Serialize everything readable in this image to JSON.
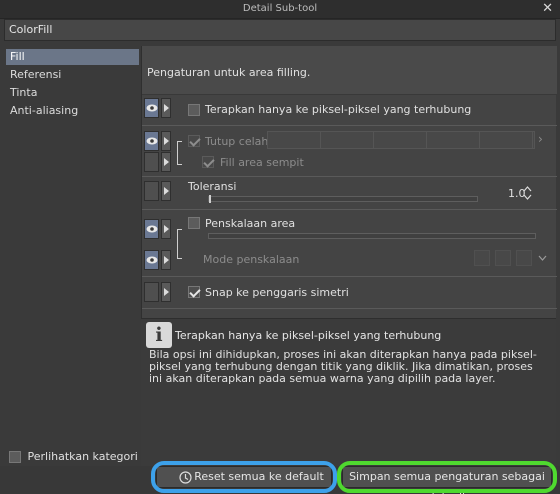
{
  "window": {
    "title": "Detail Sub-tool",
    "close_glyph": "✕"
  },
  "tool_name": "ColorFill",
  "sidebar": {
    "items": [
      {
        "label": "Fill",
        "active": true
      },
      {
        "label": "Referensi",
        "active": false
      },
      {
        "label": "Tinta",
        "active": false
      },
      {
        "label": "Anti-aliasing",
        "active": false
      }
    ],
    "show_categories_label": "Perlihatkan kategori",
    "show_categories_checked": false
  },
  "panel": {
    "header": "Pengaturan untuk area filling.",
    "settings": {
      "connected_only": {
        "label": "Terapkan hanya ke piksel-piksel yang terhubung",
        "checked": false
      },
      "close_gap": {
        "label": "Tutup celah",
        "checked": true,
        "enabled": false
      },
      "fill_narrow": {
        "label": "Fill area sempit",
        "checked": true,
        "enabled": false
      },
      "tolerance": {
        "label": "Toleransi",
        "value": "1.0"
      },
      "area_scaling": {
        "label": "Penskalaan area",
        "checked": false
      },
      "scaling_mode": {
        "label": "Mode penskalaan",
        "enabled": false
      },
      "snap_symmetry": {
        "label": "Snap ke penggaris simetri",
        "checked": true
      }
    }
  },
  "help": {
    "icon": "info-icon",
    "title": "Terapkan hanya ke piksel-piksel yang terhubung",
    "body": "Bila opsi ini dihidupkan, proses ini akan diterapkan hanya pada piksel-piksel yang terhubung dengan titik yang diklik. Jika dimatikan, proses ini akan diterapkan pada semua warna yang dipilih pada layer."
  },
  "buttons": {
    "reset_label": "Reset semua ke default",
    "save_label": "Simpan semua pengaturan sebagai default"
  },
  "colors": {
    "accent_selected": "#6b7688",
    "eye_on": "#6a7893",
    "highlight_blue": "#3da1ea",
    "highlight_green": "#4fd92f"
  }
}
